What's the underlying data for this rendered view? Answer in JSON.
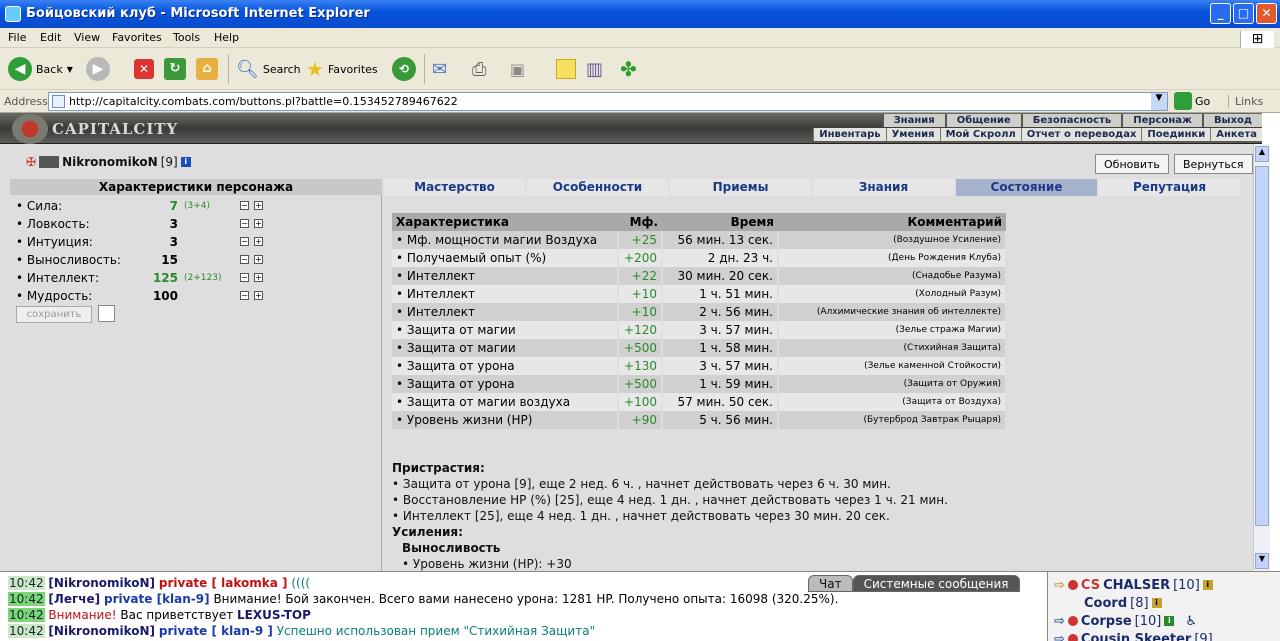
{
  "window": {
    "title": "Бойцовский клуб - Microsoft Internet Explorer",
    "min": "_",
    "max": "□",
    "close": "✕"
  },
  "menu": [
    "File",
    "Edit",
    "View",
    "Favorites",
    "Tools",
    "Help"
  ],
  "toolbar": {
    "back": "Back",
    "search": "Search",
    "favorites": "Favorites"
  },
  "address": {
    "label": "Address",
    "url": "http://capitalcity.combats.com/buttons.pl?battle=0.153452789467622",
    "go": "Go",
    "links": "Links"
  },
  "game": {
    "logo": "CAPITALCITY",
    "topnav": [
      "Знания",
      "Общение",
      "Безопасность",
      "Персонаж",
      "Выход"
    ],
    "subnav": [
      "Инвентарь",
      "Умения",
      "Мой Скролл",
      "Отчет о переводах",
      "Поединки",
      "Анкета"
    ]
  },
  "character": {
    "name": "NikronomikoN",
    "level": "[9]",
    "info": "i"
  },
  "buttons": {
    "refresh": "Обновить",
    "back": "Вернуться",
    "save": "сохранить"
  },
  "left_panel": {
    "title": "Характеристики персонажа",
    "stats": [
      {
        "name": "• Сила:",
        "value": "7",
        "extra": "(3+4)",
        "color": "#2a8a2a"
      },
      {
        "name": "• Ловкость:",
        "value": "3",
        "extra": "",
        "color": "#000000"
      },
      {
        "name": "• Интуиция:",
        "value": "3",
        "extra": "",
        "color": "#000000"
      },
      {
        "name": "• Выносливость:",
        "value": "15",
        "extra": "",
        "color": "#000000"
      },
      {
        "name": "• Интеллект:",
        "value": "125",
        "extra": "(2+123)",
        "color": "#2a8a2a"
      },
      {
        "name": "• Мудрость:",
        "value": "100",
        "extra": "",
        "color": "#000000"
      }
    ]
  },
  "tabs": [
    "Мастерство",
    "Особенности",
    "Приемы",
    "Знания",
    "Состояние",
    "Репутация"
  ],
  "active_tab": "Состояние",
  "table": {
    "headers": [
      "Характеристика",
      "Мф.",
      "Время",
      "Комментарий"
    ],
    "rows": [
      [
        "• Мф. мощности магии Воздуха",
        "+25",
        "56 мин. 13 сек.",
        "(Воздушное Усиление)"
      ],
      [
        "• Получаемый опыт (%)",
        "+200",
        "2 дн. 23 ч.",
        "(День Рождения Клуба)"
      ],
      [
        "• Интеллект",
        "+22",
        "30 мин. 20 сек.",
        "(Снадобье Разума)"
      ],
      [
        "• Интеллект",
        "+10",
        "1 ч. 51 мин.",
        "(Холодный Разум)"
      ],
      [
        "• Интеллект",
        "+10",
        "2 ч. 56 мин.",
        "(Алхимические знания об интеллекте)"
      ],
      [
        "• Защита от магии",
        "+120",
        "3 ч. 57 мин.",
        "(Зелье стража Магии)"
      ],
      [
        "• Защита от магии",
        "+500",
        "1 ч. 58 мин.",
        "(Стихийная Защита)"
      ],
      [
        "• Защита от урона",
        "+130",
        "3 ч. 57 мин.",
        "(Зелье каменной Стойкости)"
      ],
      [
        "• Защита от урона",
        "+500",
        "1 ч. 59 мин.",
        "(Защита от Оружия)"
      ],
      [
        "• Защита от магии воздуха",
        "+100",
        "57 мин. 50 сек.",
        "(Защита от Воздуха)"
      ],
      [
        "• Уровень жизни (HP)",
        "+90",
        "5 ч. 56 мин.",
        "(Бутерброд Завтрак Рыцаря)"
      ]
    ]
  },
  "addictions": {
    "title": "Пристрастия:",
    "items": [
      "• Защита от урона [9], еще 2 нед. 6 ч. , начнет действовать через 6 ч. 30 мин.",
      "• Восстановление HP (%) [25], еще 4 нед. 1 дн. , начнет действовать через 1 ч. 21 мин.",
      "• Интеллект [25], еще 4 нед. 1 дн. , начнет действовать через 30 мин. 20 сек."
    ],
    "boosts_title": "Усиления:",
    "boost_group": "Выносливость",
    "boost_item": "• Уровень жизни (HP): +30"
  },
  "chat": {
    "tabs": [
      "Чат",
      "Системные сообщения"
    ],
    "lines": [
      {
        "time": "10:42",
        "nick": "[NikronomikoN]",
        "tag": "private [ lakomka ]",
        "text": " (((("
      },
      {
        "time": "10:42",
        "nick": "[Легче]",
        "tag": "private [klan-9]",
        "text": " Внимание! Бой закончен. Всего вами нанесено урона: 1281 HP. Получено опыта: 16098 (320.25%)."
      },
      {
        "time": "10:42",
        "warn": "Внимание!",
        "text": " Вас приветствует ",
        "bold": "LEXUS-TOP"
      },
      {
        "time": "10:42",
        "nick": "[NikronomikoN]",
        "tag": "private [ klan-9 ]",
        "text": " Успешно использован прием \"Стихийная Защита\""
      }
    ]
  },
  "users": [
    {
      "tag": "CS",
      "name": "CHALSER",
      "level": "[10]"
    },
    {
      "tag": "",
      "name": "Coord",
      "level": "[8]"
    },
    {
      "tag": "",
      "name": "Corpse",
      "level": "[10]"
    },
    {
      "tag": "",
      "name": "Cousin Skeeter",
      "level": "[9]"
    }
  ]
}
